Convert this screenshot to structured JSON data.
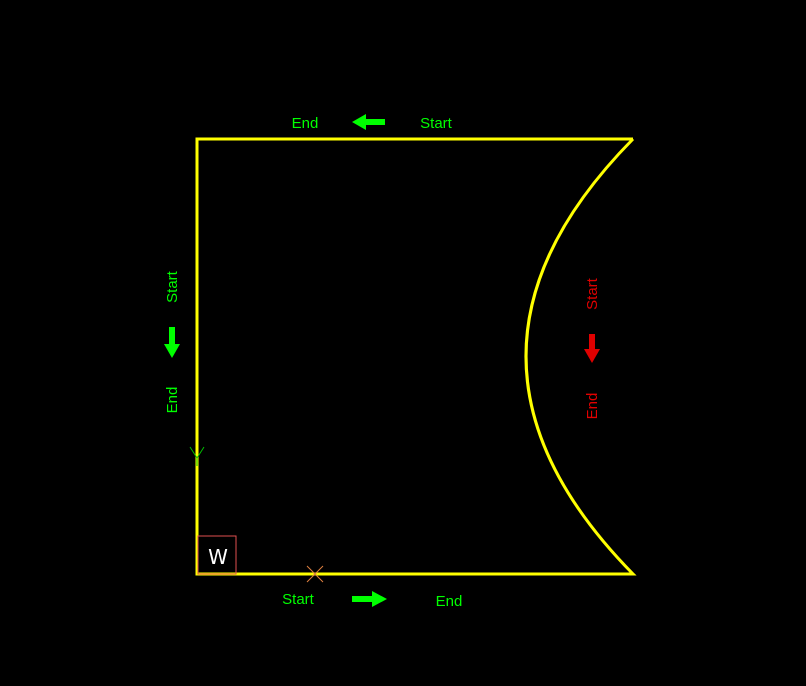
{
  "colors": {
    "background": "#000000",
    "outline": "#ffff00",
    "label_green": "#00ff00",
    "label_red": "#e00000",
    "ucs_box": "#e05050",
    "ucs_letter": "#ffffff",
    "cross_marker": "#e08040"
  },
  "edges": {
    "top": {
      "start_label": "Start",
      "end_label": "End",
      "direction": "left",
      "color": "green"
    },
    "left": {
      "start_label": "Start",
      "end_label": "End",
      "direction": "down",
      "color": "green"
    },
    "bottom": {
      "start_label": "Start",
      "end_label": "End",
      "direction": "right",
      "color": "green"
    },
    "arc": {
      "start_label": "Start",
      "end_label": "End",
      "direction": "down",
      "color": "red"
    }
  },
  "ucs_icon": {
    "letter": "W"
  },
  "icons": [
    "arrow-left-icon",
    "arrow-down-icon",
    "arrow-right-icon",
    "cross-marker-icon",
    "chevron-marker-icon"
  ]
}
